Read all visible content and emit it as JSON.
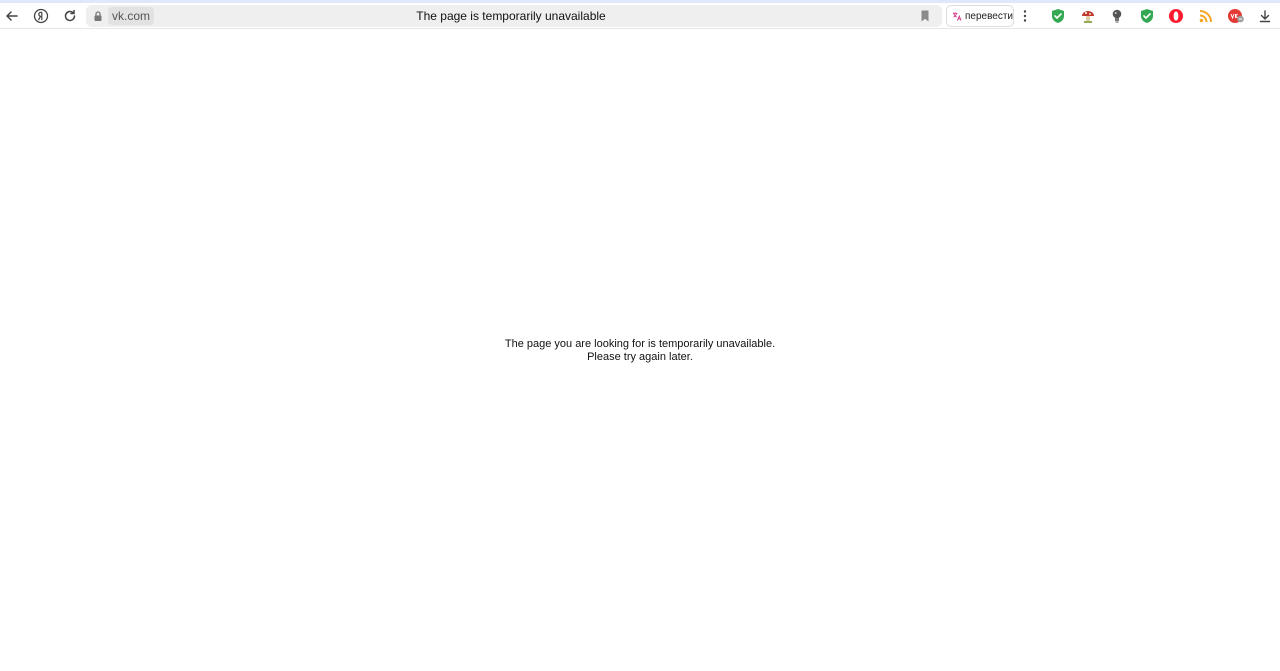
{
  "browser": {
    "address": {
      "domain": "vk.com",
      "title": "The page is temporarily unavailable"
    },
    "translate": {
      "label": "перевести"
    },
    "extensions": [
      {
        "name": "shield-check-icon",
        "color": "#34a853"
      },
      {
        "name": "mushroom-icon",
        "color": "#c0392b"
      },
      {
        "name": "lightbulb-icon",
        "color": "#555555"
      },
      {
        "name": "shield-check-icon",
        "color": "#34a853"
      },
      {
        "name": "opera-icon",
        "color": "#ff1b2d"
      },
      {
        "name": "rss-icon",
        "color": "#f5a623"
      },
      {
        "name": "vk-badge-icon",
        "color": "#e53935"
      },
      {
        "name": "download-icon",
        "color": "#444444"
      }
    ],
    "accent": "#dfe8fb"
  },
  "page": {
    "message_line1": "The page you are looking for is temporarily unavailable.",
    "message_line2": "Please try again later."
  }
}
